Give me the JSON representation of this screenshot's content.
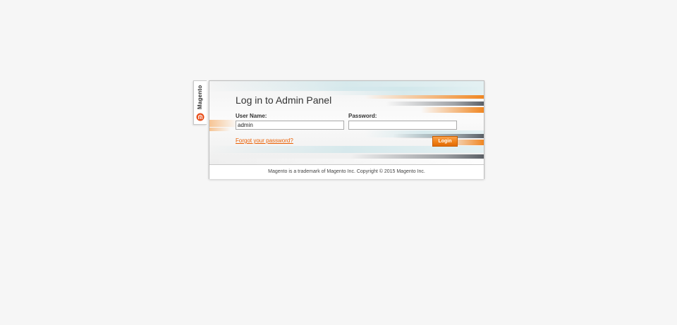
{
  "brand": {
    "name": "Magento",
    "logo_icon": "magento-logo-icon"
  },
  "login": {
    "title": "Log in to Admin Panel",
    "username_label": "User Name:",
    "username_value": "admin",
    "password_label": "Password:",
    "password_value": "",
    "forgot_link": "Forgot your password?",
    "login_button": "Login"
  },
  "footer": {
    "text": "Magento is a trademark of Magento Inc. Copyright © 2015 Magento Inc."
  },
  "colors": {
    "accent": "#f08117",
    "link": "#eb5e00",
    "background": "#f6f6f6"
  }
}
